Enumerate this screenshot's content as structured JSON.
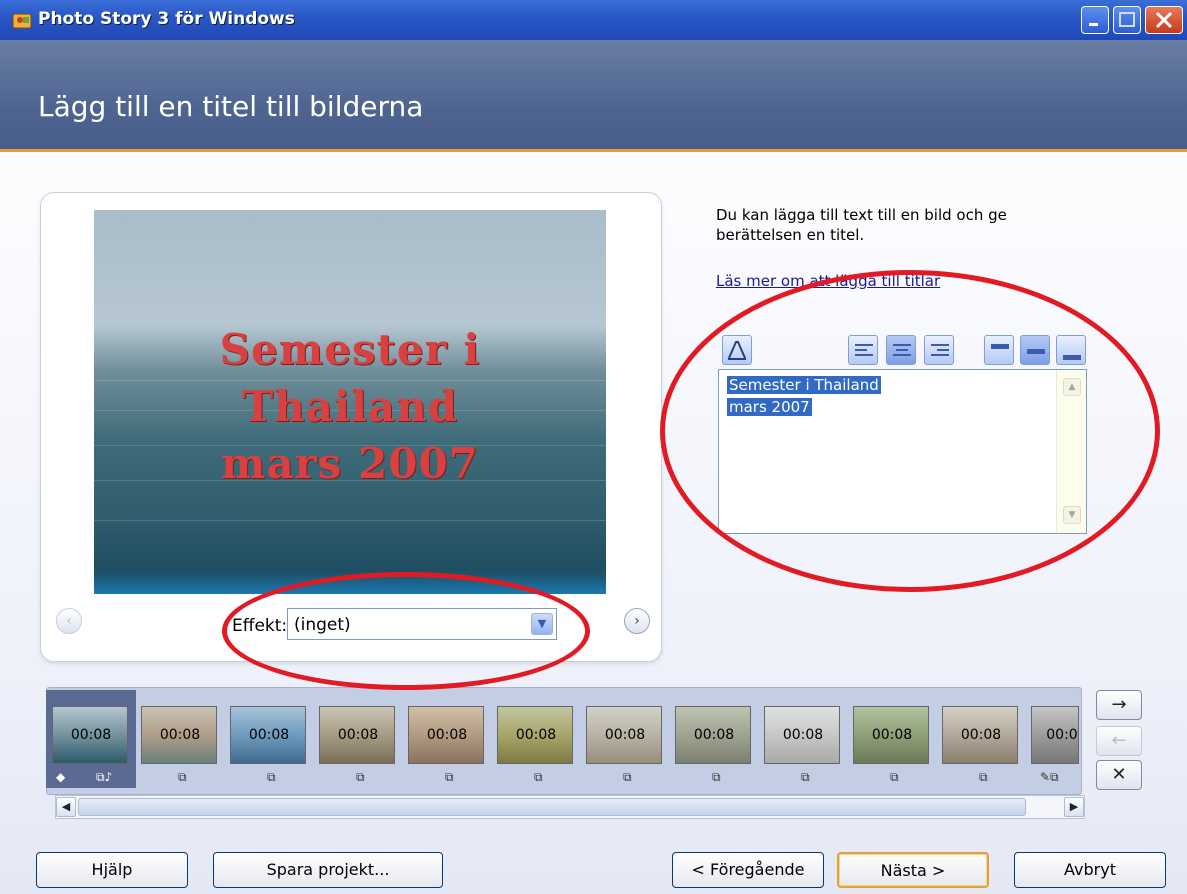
{
  "window": {
    "title": "Photo Story 3 för Windows"
  },
  "header": {
    "title": "Lägg till en titel till bilderna"
  },
  "preview": {
    "title_lines": [
      "Semester i",
      "Thailand",
      "mars 2007"
    ],
    "effect_label": "Effekt:",
    "effect_value": "(inget)"
  },
  "sidebar": {
    "description": "Du kan lägga till text till en bild och ge berättelsen en titel.",
    "learn_more_link": "Läs mer om att lägga till titlar",
    "title_text_lines": [
      "Semester i Thailand",
      "mars 2007"
    ]
  },
  "filmstrip": {
    "thumbnails": [
      {
        "time": "00:08"
      },
      {
        "time": "00:08"
      },
      {
        "time": "00:08"
      },
      {
        "time": "00:08"
      },
      {
        "time": "00:08"
      },
      {
        "time": "00:08"
      },
      {
        "time": "00:08"
      },
      {
        "time": "00:08"
      },
      {
        "time": "00:08"
      },
      {
        "time": "00:08"
      },
      {
        "time": "00:08"
      },
      {
        "time": "00:0"
      }
    ]
  },
  "buttons": {
    "help": "Hjälp",
    "save_project": "Spara projekt...",
    "previous": "< Föregående",
    "next": "Nästa >",
    "cancel": "Avbryt"
  },
  "icons": {
    "move_right": "→",
    "move_left": "←",
    "remove": "✕",
    "prev_nav": "‹",
    "next_nav": "›"
  },
  "colors": {
    "highlight_ellipse": "#e21a24",
    "title_bar": "#2a58c8",
    "accent_gold": "#e2a13b",
    "photo_title_text": "#d94040"
  }
}
